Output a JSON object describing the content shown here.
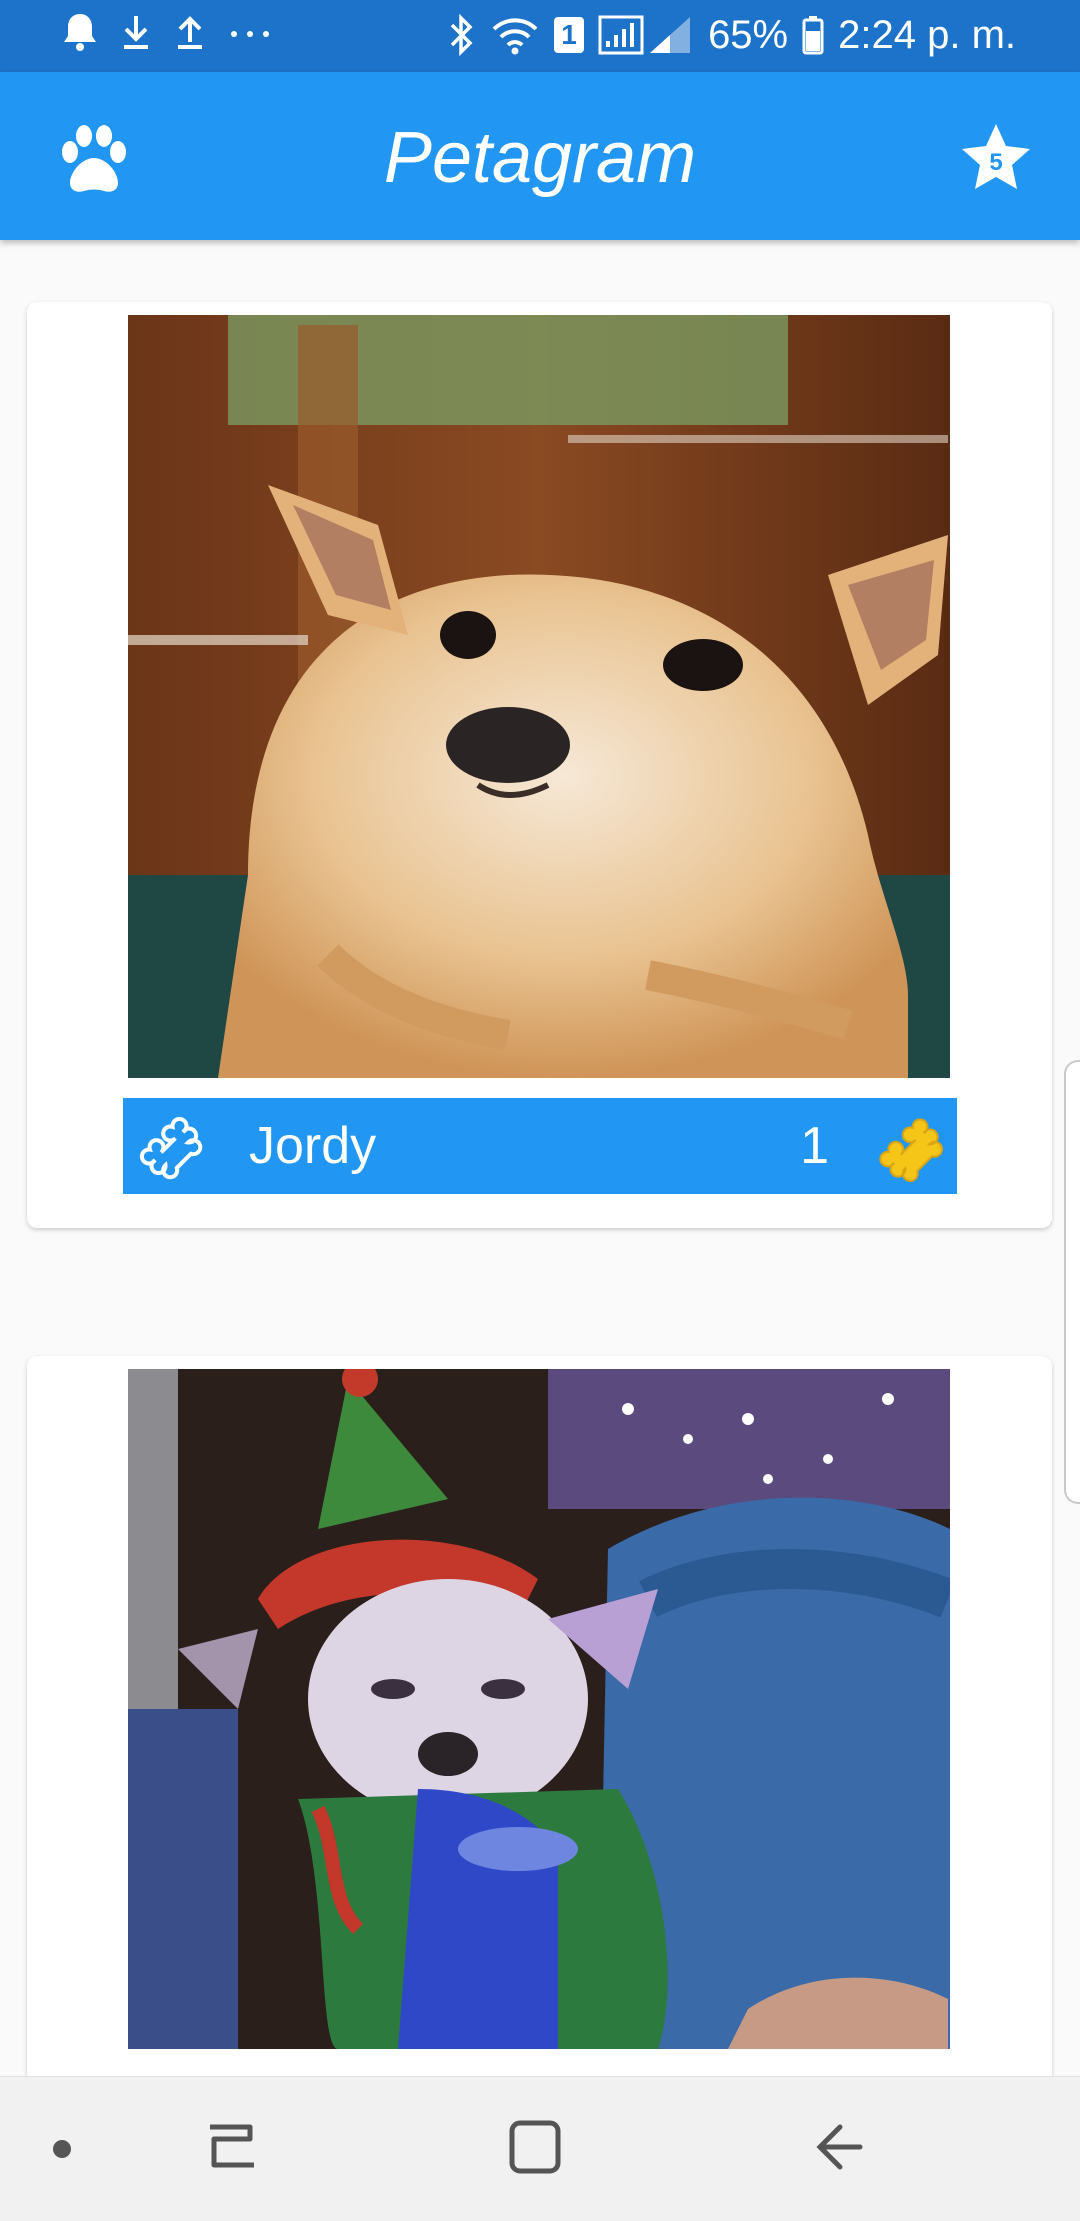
{
  "status_bar": {
    "battery": "65%",
    "time": "2:24 p. m.",
    "wifi_badge": "1",
    "icons": [
      "notification-bell-icon",
      "download-icon",
      "upload-icon",
      "more-dots-icon",
      "bluetooth-icon",
      "wifi-icon",
      "signal-icon",
      "battery-icon"
    ]
  },
  "app_bar": {
    "title": "Petagram",
    "left_icon": "paw-icon",
    "right_icon": "star-icon",
    "star_badge": "5"
  },
  "pets": [
    {
      "name": "Jordy",
      "likes": "1",
      "photo": "chihuahua-photo"
    },
    {
      "name": "",
      "likes": "",
      "photo": "chihuahua-elf-photo"
    }
  ],
  "nav_bar": {
    "icons": [
      "dot-icon",
      "recent-apps-icon",
      "home-icon",
      "back-icon"
    ]
  },
  "colors": {
    "primary": "#2196f3",
    "primary_dark": "#1d72c9",
    "bone_gold": "#f5c518"
  }
}
